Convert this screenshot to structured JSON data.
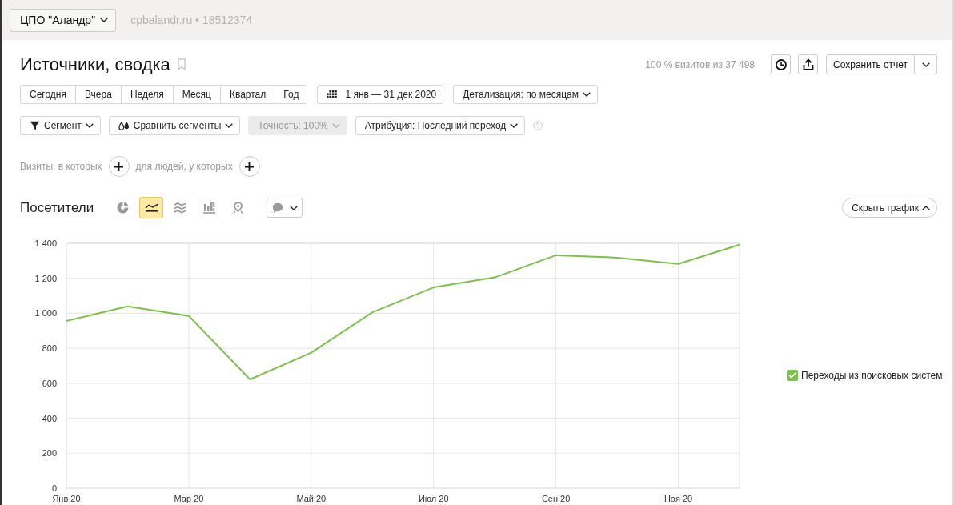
{
  "top_bar": {
    "counter": "ЦПО \"Аландр\"",
    "site": "cpbalandr.ru • 18512374"
  },
  "header": {
    "title": "Источники, сводка",
    "sample_info": "100 % визитов из 37 498",
    "save_button": "Сохранить отчет"
  },
  "periods": [
    {
      "label": "Сегодня",
      "selected": false
    },
    {
      "label": "Вчера",
      "selected": false
    },
    {
      "label": "Неделя",
      "selected": false
    },
    {
      "label": "Месяц",
      "selected": false
    },
    {
      "label": "Квартал",
      "selected": false
    },
    {
      "label": "Год",
      "selected": false
    }
  ],
  "date_range": "1 янв — 31 дек 2020",
  "grouping": "Детализация: по месяцам",
  "filters": [
    {
      "kind": "segment",
      "label": "Сегмент",
      "disabled": false
    },
    {
      "kind": "compare",
      "label": "Сравнить сегменты",
      "disabled": false
    },
    {
      "kind": "select",
      "label": "Точность: 100%",
      "disabled": true
    },
    {
      "kind": "select",
      "label": "Атрибуция: Последний переход",
      "disabled": false
    }
  ],
  "conditions": [
    {
      "label": "Визиты, в которых"
    },
    {
      "label": "для людей, у которых"
    }
  ],
  "chart_panel": {
    "title": "Посетители",
    "chart_types": [
      {
        "kind": "pie",
        "selected": false
      },
      {
        "kind": "line",
        "selected": true
      },
      {
        "kind": "area",
        "selected": false
      },
      {
        "kind": "bar",
        "selected": false
      },
      {
        "kind": "map",
        "selected": false
      }
    ],
    "hide_button": "Скрыть график",
    "legend": [
      {
        "checked": true
      }
    ],
    "chart_data": {
      "type": "line",
      "grid": true,
      "categories": [
        "Янв 20",
        null,
        "Мар 20",
        null,
        "Май 20",
        null,
        "Июл 20",
        null,
        "Сен 20",
        null,
        "Ноя 20",
        null
      ],
      "ylim": [
        0,
        1400
      ],
      "yticks": [
        0,
        200,
        400,
        600,
        800,
        {
          "value": 1000,
          "label": "1 000"
        },
        {
          "value": 1200,
          "label": "1 200"
        },
        {
          "value": 1400,
          "label": "1 400"
        }
      ],
      "series": [
        {
          "name": "Переходы из поисковых систем",
          "color": "#7fbf4f",
          "values": [
            956,
            1040,
            985,
            622,
            775,
            1006,
            1148,
            1205,
            1332,
            1318,
            1282,
            1392
          ]
        }
      ]
    }
  }
}
